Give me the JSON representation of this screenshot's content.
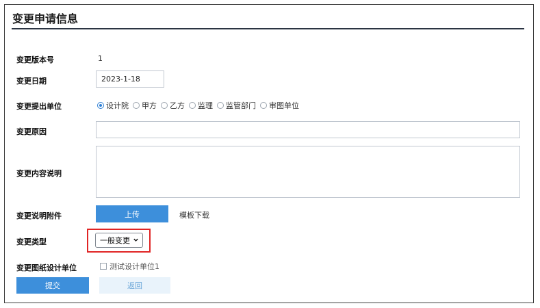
{
  "section": {
    "title": "变更申请信息"
  },
  "fields": {
    "version": {
      "label": "变更版本号",
      "value": "1"
    },
    "date": {
      "label": "变更日期",
      "value": "2023-1-18"
    },
    "submitter": {
      "label": "变更提出单位",
      "options": [
        "设计院",
        "甲方",
        "乙方",
        "监理",
        "监管部门",
        "审图单位"
      ],
      "selected": "设计院"
    },
    "reason": {
      "label": "变更原因",
      "value": ""
    },
    "content": {
      "label": "变更内容说明",
      "value": ""
    },
    "attachment": {
      "label": "变更说明附件",
      "upload_label": "上传",
      "template_link": "模板下载"
    },
    "type": {
      "label": "变更类型",
      "selected": "一般变更"
    },
    "design_unit": {
      "label": "变更图纸设计单位",
      "option": "测试设计单位1",
      "checked": false
    }
  },
  "actions": {
    "submit_label": "提交",
    "back_label": "返回"
  },
  "colors": {
    "primary": "#3d8fdb",
    "highlight": "#e02424"
  }
}
